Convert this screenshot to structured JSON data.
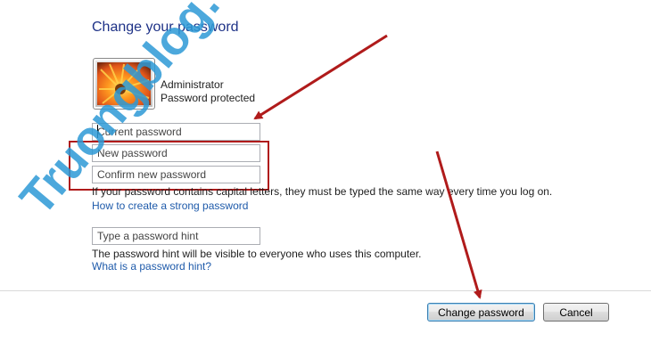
{
  "page": {
    "title": "Change your password"
  },
  "user": {
    "name": "Administrator",
    "status": "Password protected"
  },
  "fields": {
    "current_password": "Current password",
    "new_password": "New password",
    "confirm_password": "Confirm new password",
    "password_hint": "Type a password hint"
  },
  "notes": {
    "capital_letters": "If your password contains capital letters, they must be typed the same way every time you log on.",
    "strong_password_link": "How to create a strong password",
    "hint_visibility": "The password hint will be visible to everyone who uses this computer.",
    "hint_link": "What is a password hint?"
  },
  "buttons": {
    "change_password": "Change password",
    "cancel": "Cancel"
  },
  "watermark": {
    "text": "Truongblog.com"
  },
  "colors": {
    "title": "#1e3287",
    "link": "#1e5aaa",
    "annotation_red": "#b01b1b",
    "watermark": "#2d9ad6"
  },
  "icons": {
    "avatar": "flower-avatar-icon"
  }
}
